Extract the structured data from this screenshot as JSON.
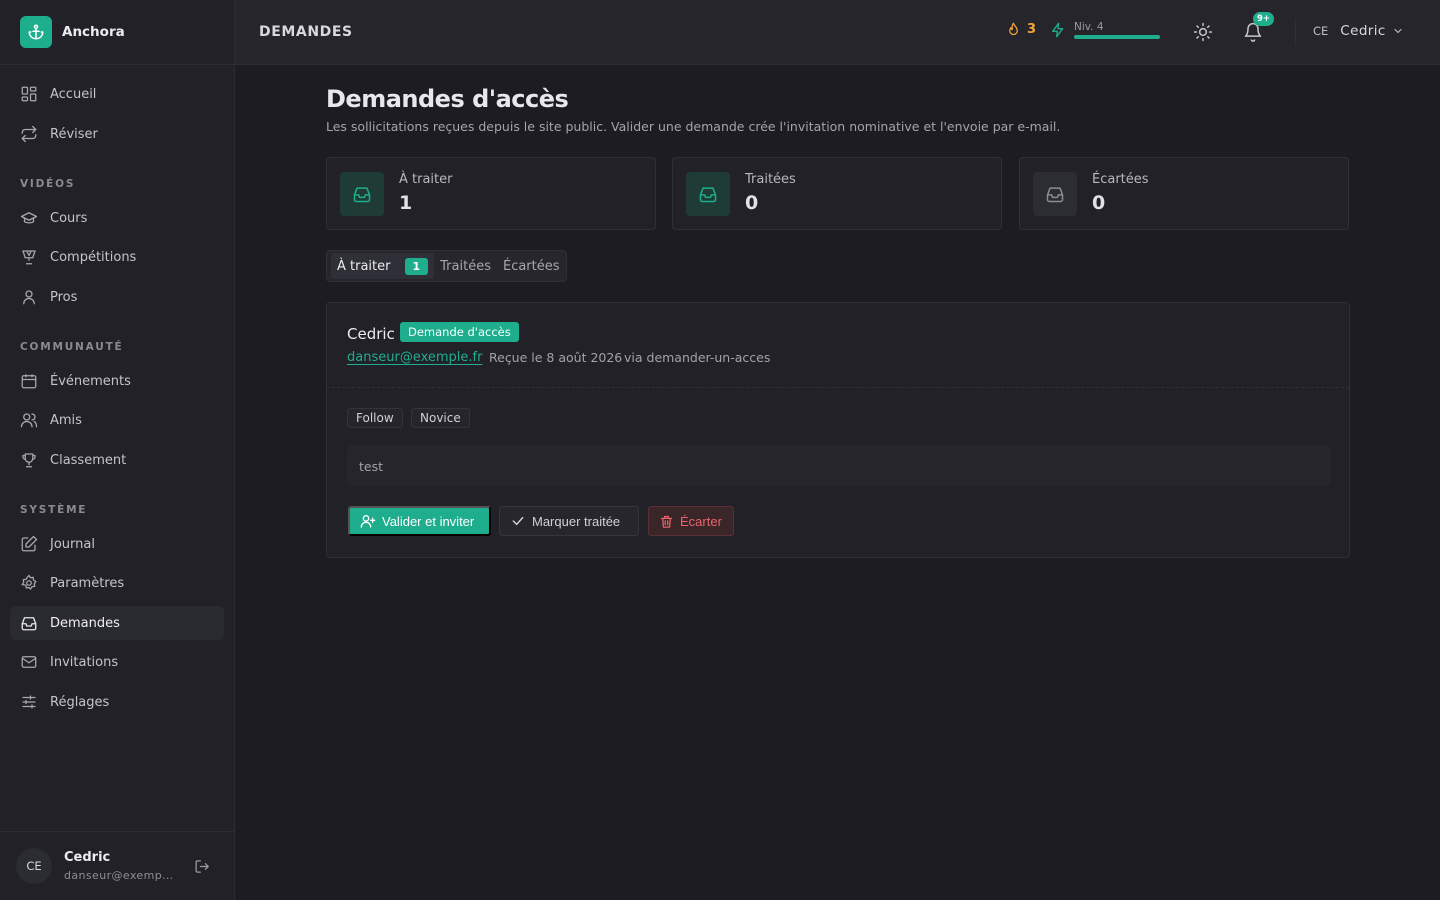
{
  "brand": {
    "name": "Anchora",
    "logo_icon": "anchor-icon",
    "accent": "#1fae8d"
  },
  "sidebar": {
    "items": [
      {
        "label": "Accueil",
        "icon": "dashboard-icon"
      },
      {
        "label": "Réviser",
        "icon": "repeat-icon"
      }
    ],
    "sections": [
      {
        "title": "VIDÉOS",
        "items": [
          {
            "label": "Cours",
            "icon": "graduation-cap-icon"
          },
          {
            "label": "Compétitions",
            "icon": "trophy-badge-icon"
          },
          {
            "label": "Pros",
            "icon": "user-icon"
          }
        ]
      },
      {
        "title": "COMMUNAUTÉ",
        "items": [
          {
            "label": "Événements",
            "icon": "calendar-icon"
          },
          {
            "label": "Amis",
            "icon": "users-icon"
          },
          {
            "label": "Classement",
            "icon": "trophy-icon"
          }
        ]
      },
      {
        "title": "SYSTÈME",
        "items": [
          {
            "label": "Journal",
            "icon": "edit-icon"
          },
          {
            "label": "Paramètres",
            "icon": "gear-icon"
          },
          {
            "label": "Demandes",
            "icon": "inbox-icon",
            "active": true
          },
          {
            "label": "Invitations",
            "icon": "mail-icon"
          },
          {
            "label": "Réglages",
            "icon": "sliders-icon"
          }
        ]
      }
    ],
    "user": {
      "initials": "CE",
      "name": "Cedric",
      "email": "danseur@exempl..."
    }
  },
  "header": {
    "page_label": "DEMANDES",
    "streak": "3",
    "level_label": "Niv. 4",
    "level_progress": 1.0,
    "notifications_badge": "9+",
    "user_initials": "CE",
    "user_name": "Cedric"
  },
  "main": {
    "title": "Demandes d'accès",
    "subtitle": "Les sollicitations reçues depuis le site public. Valider une demande crée l'invitation nominative et l'envoie par e-mail.",
    "stats": [
      {
        "label": "À traiter",
        "value": "1",
        "tone": "green"
      },
      {
        "label": "Traitées",
        "value": "0",
        "tone": "green"
      },
      {
        "label": "Écartées",
        "value": "0",
        "tone": "grey"
      }
    ],
    "tabs": {
      "active_label": "À traiter",
      "active_count": "1",
      "second": "Traitées",
      "third": "Écartées"
    },
    "request": {
      "name": "Cedric",
      "badge": "Demande d'accès",
      "email": "danseur@exemple.fr",
      "received": "Reçue le 8 août 2026",
      "via": "via demander-un-acces",
      "tags": [
        "Follow",
        "Novice"
      ],
      "message": "test",
      "actions": {
        "validate": "Valider et inviter",
        "mark_done": "Marquer traitée",
        "discard": "Écarter"
      }
    }
  }
}
